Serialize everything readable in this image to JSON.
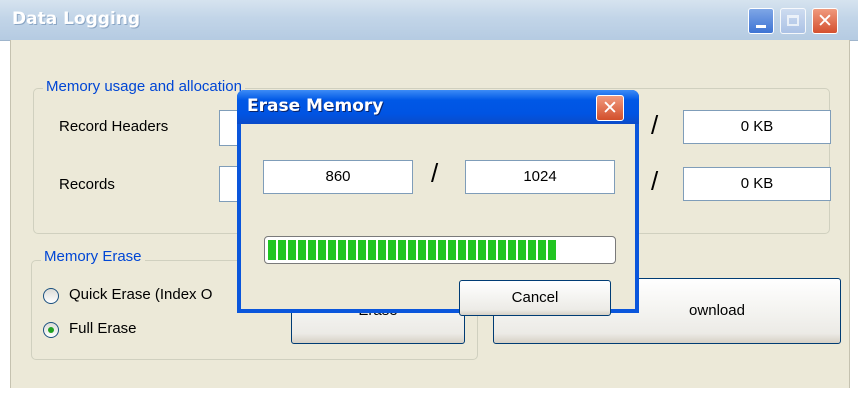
{
  "main_window": {
    "title": "Data Logging",
    "memory_group": {
      "legend": "Memory usage and allocation",
      "rows": [
        {
          "label": "Record Headers",
          "right_value": "0 KB",
          "separator": "/"
        },
        {
          "label": "Records",
          "right_value": "0 KB",
          "separator": "/"
        }
      ]
    },
    "erase_group": {
      "legend": "Memory Erase",
      "quick_erase_label": "Quick Erase (Index O",
      "full_erase_label": "Full Erase",
      "selected": "Full Erase"
    },
    "erase_button_label": "Erase",
    "download_button_label": "ownload"
  },
  "dialog": {
    "title": "Erase Memory",
    "current_value": "860",
    "separator": "/",
    "total_value": "1024",
    "progress_fraction": 0.84,
    "cancel_label": "Cancel"
  },
  "colors": {
    "dialog_titlebar": "#0054e3",
    "progress_fill": "#21c521",
    "legend_text": "#0046d5",
    "client_background": "#ece9d8"
  },
  "icons": {
    "minimize": "minimize-icon",
    "maximize": "maximize-icon",
    "close": "close-icon"
  }
}
